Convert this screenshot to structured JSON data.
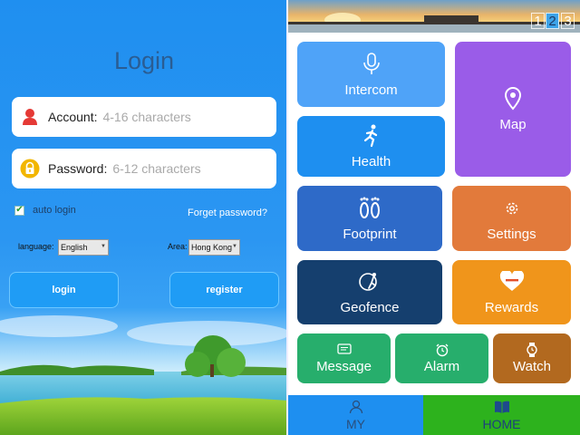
{
  "login": {
    "title": "Login",
    "account_label": "Account:",
    "account_placeholder": "4-16 characters",
    "password_label": "Password:",
    "password_placeholder": "6-12 characters",
    "auto_login_label": "auto login",
    "auto_login_checked": true,
    "forget_password": "Forget password?",
    "language_label": "language:",
    "language_value": "English",
    "area_label": "Area:",
    "area_value": "Hong Kong",
    "login_button": "login",
    "register_button": "register"
  },
  "home": {
    "pages": [
      "1",
      "2",
      "3"
    ],
    "active_page": 2,
    "tiles": [
      {
        "label": "Intercom",
        "icon": "microphone-icon",
        "color": "#4fa3f8"
      },
      {
        "label": "Map",
        "icon": "map-pin-icon",
        "color": "#9a5ce8"
      },
      {
        "label": "Health",
        "icon": "runner-icon",
        "color": "#1e8ff0"
      },
      {
        "label": "Footprint",
        "icon": "footprints-icon",
        "color": "#2e6ac8"
      },
      {
        "label": "Settings",
        "icon": "gear-icon",
        "color": "#e27a3b"
      },
      {
        "label": "Geofence",
        "icon": "geofence-icon",
        "color": "#153f6e"
      },
      {
        "label": "Rewards",
        "icon": "heart-icon",
        "color": "#f0951b"
      },
      {
        "label": "Message",
        "icon": "message-icon",
        "color": "#27ae6c"
      },
      {
        "label": "Alarm",
        "icon": "alarm-clock-icon",
        "color": "#27ae6c"
      },
      {
        "label": "Watch",
        "icon": "watch-icon",
        "color": "#b2691f"
      }
    ],
    "tabs": [
      {
        "label": "MY",
        "icon": "person-icon",
        "color": "#1e8ff0"
      },
      {
        "label": "HOME",
        "icon": "book-icon",
        "color": "#2db21d"
      }
    ]
  }
}
